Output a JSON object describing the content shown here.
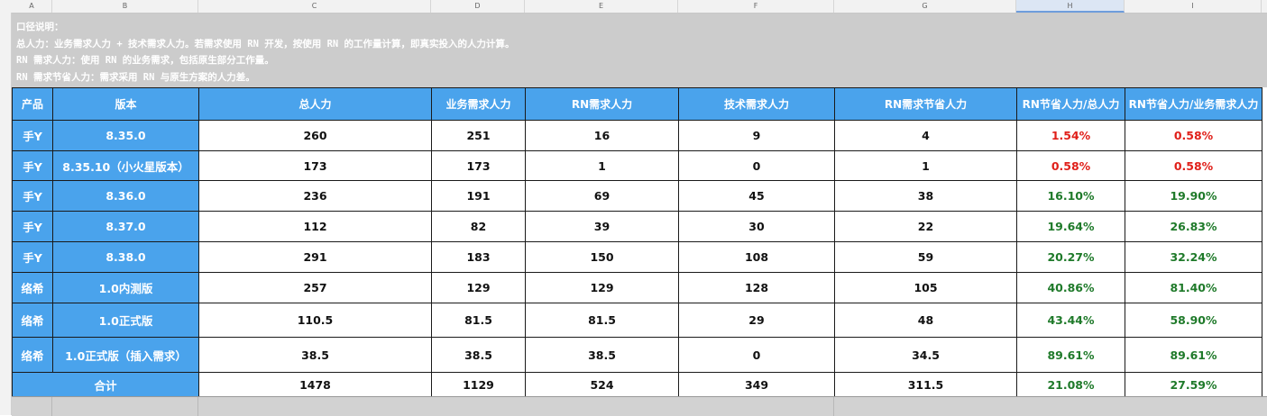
{
  "columns": [
    "A",
    "B",
    "C",
    "D",
    "E",
    "F",
    "G",
    "H",
    "I"
  ],
  "notes": [
    "口径说明：",
    "总人力：业务需求人力 + 技术需求人力。若需求使用 RN 开发，按使用 RN 的工作量计算，即真实投入的人力计算。",
    "RN 需求人力：使用 RN 的业务需求，包括原生部分工作量。",
    "RN 需求节省人力：需求采用 RN 与原生方案的人力差。"
  ],
  "table": {
    "headers": [
      "产品",
      "版本",
      "总人力",
      "业务需求人力",
      "RN需求人力",
      "技术需求人力",
      "RN需求节省人力",
      "RN节省人力/总人力",
      "RN节省人力/业务需求人力"
    ],
    "rows": [
      {
        "product": "手Y",
        "version": "8.35.0",
        "total": "260",
        "biz": "251",
        "rn": "16",
        "tech": "9",
        "saved": "4",
        "ratio_total": "1.54%",
        "ratio_biz": "0.58%",
        "color_total": "red",
        "color_biz": "red"
      },
      {
        "product": "手Y",
        "version": "8.35.10（小火星版本）",
        "total": "173",
        "biz": "173",
        "rn": "1",
        "tech": "0",
        "saved": "1",
        "ratio_total": "0.58%",
        "ratio_biz": "0.58%",
        "color_total": "red",
        "color_biz": "red"
      },
      {
        "product": "手Y",
        "version": "8.36.0",
        "total": "236",
        "biz": "191",
        "rn": "69",
        "tech": "45",
        "saved": "38",
        "ratio_total": "16.10%",
        "ratio_biz": "19.90%",
        "color_total": "green",
        "color_biz": "green"
      },
      {
        "product": "手Y",
        "version": "8.37.0",
        "total": "112",
        "biz": "82",
        "rn": "39",
        "tech": "30",
        "saved": "22",
        "ratio_total": "19.64%",
        "ratio_biz": "26.83%",
        "color_total": "green",
        "color_biz": "green"
      },
      {
        "product": "手Y",
        "version": "8.38.0",
        "total": "291",
        "biz": "183",
        "rn": "150",
        "tech": "108",
        "saved": "59",
        "ratio_total": "20.27%",
        "ratio_biz": "32.24%",
        "color_total": "green",
        "color_biz": "green"
      },
      {
        "product": "络希",
        "version": "1.0内测版",
        "total": "257",
        "biz": "129",
        "rn": "129",
        "tech": "128",
        "saved": "105",
        "ratio_total": "40.86%",
        "ratio_biz": "81.40%",
        "color_total": "green",
        "color_biz": "green"
      },
      {
        "product": "络希",
        "version": "1.0正式版",
        "total": "110.5",
        "biz": "81.5",
        "rn": "81.5",
        "tech": "29",
        "saved": "48",
        "ratio_total": "43.44%",
        "ratio_biz": "58.90%",
        "color_total": "green",
        "color_biz": "green"
      },
      {
        "product": "络希",
        "version": "1.0正式版（插入需求）",
        "total": "38.5",
        "biz": "38.5",
        "rn": "38.5",
        "tech": "0",
        "saved": "34.5",
        "ratio_total": "89.61%",
        "ratio_biz": "89.61%",
        "color_total": "green",
        "color_biz": "green"
      }
    ],
    "total_row": {
      "label": "合计",
      "total": "1478",
      "biz": "1129",
      "rn": "524",
      "tech": "349",
      "saved": "311.5",
      "ratio_total": "21.08%",
      "ratio_biz": "27.59%",
      "color_total": "green",
      "color_biz": "green"
    }
  },
  "colors": {
    "header_blue": "#4aa3ec",
    "red": "#e0201a",
    "green": "#1f7a2a",
    "note_bg": "#cccccc"
  }
}
